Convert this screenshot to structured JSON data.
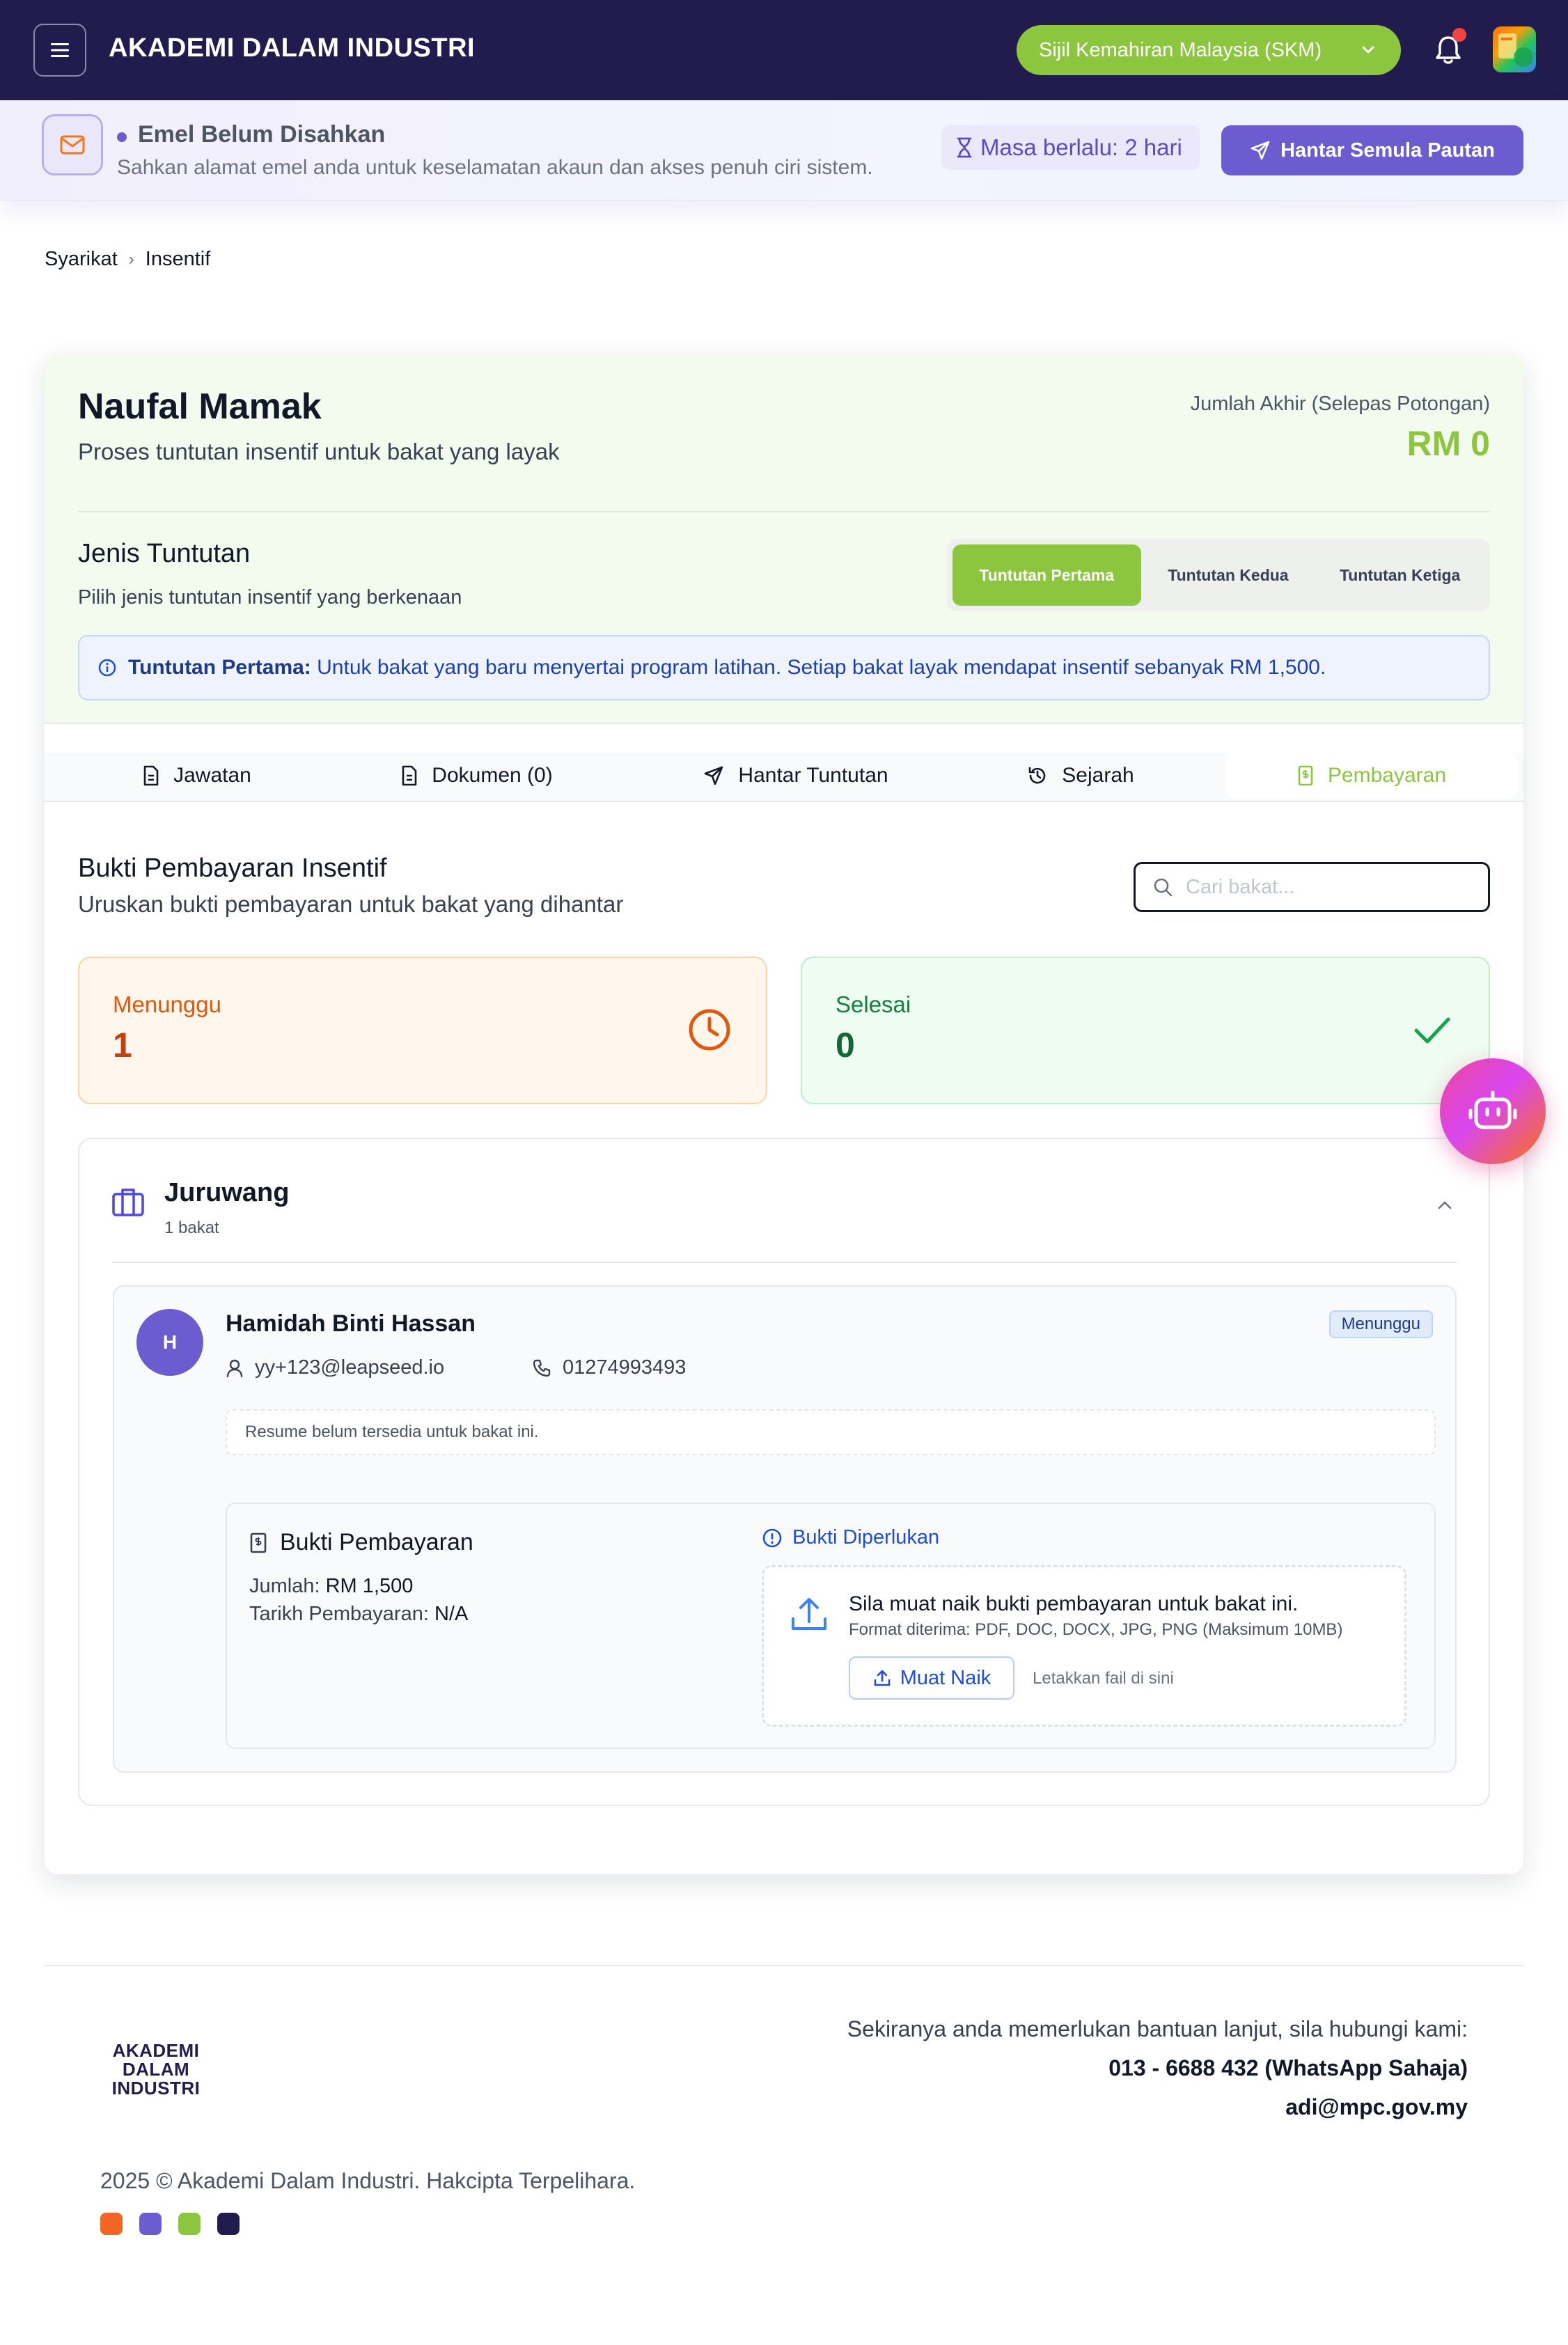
{
  "header": {
    "app_title": "AKADEMI DALAM INDUSTRI",
    "program_select": "Sijil Kemahiran Malaysia (SKM)",
    "icons": [
      "menu-icon",
      "chevron-down-icon",
      "bell-icon",
      "avatar"
    ]
  },
  "banner": {
    "title": "Emel Belum Disahkan",
    "subtitle": "Sahkan alamat emel anda untuk keselamatan akaun dan akses penuh ciri sistem.",
    "elapsed": "Masa berlalu: 2 hari",
    "resend_label": "Hantar Semula Pautan"
  },
  "breadcrumb": {
    "items": [
      "Syarikat",
      "Insentif"
    ],
    "separator": "›"
  },
  "profile": {
    "name": "Naufal Mamak",
    "subtitle": "Proses tuntutan insentif untuk bakat yang layak",
    "total_label": "Jumlah Akhir (Selepas Potongan)",
    "total_value": "RM 0"
  },
  "claim_type": {
    "title": "Jenis Tuntutan",
    "subtitle": "Pilih jenis tuntutan insentif yang berkenaan",
    "options": [
      "Tuntutan Pertama",
      "Tuntutan Kedua",
      "Tuntutan Ketiga"
    ],
    "selected": "Tuntutan Pertama",
    "info_bold": "Tuntutan Pertama:",
    "info_text": " Untuk bakat yang baru menyertai program latihan. Setiap bakat layak mendapat insentif sebanyak RM 1,500."
  },
  "tabs": {
    "items": [
      "Jawatan",
      "Dokumen (0)",
      "Hantar Tuntutan",
      "Sejarah",
      "Pembayaran"
    ],
    "active": "Pembayaran"
  },
  "payment": {
    "title": "Bukti Pembayaran Insentif",
    "subtitle": "Uruskan bukti pembayaran untuk bakat yang dihantar",
    "search_placeholder": "Cari bakat...",
    "stats": {
      "pending_label": "Menunggu",
      "pending_value": "1",
      "done_label": "Selesai",
      "done_value": "0"
    }
  },
  "group": {
    "title": "Juruwang",
    "count": "1 bakat",
    "talent": {
      "initial": "H",
      "name": "Hamidah Binti Hassan",
      "status": "Menunggu",
      "email": "yy+123@leapseed.io",
      "phone": "01274993493",
      "resume_note": "Resume belum tersedia untuk bakat ini.",
      "proof": {
        "title": "Bukti Pembayaran",
        "amount_label": "Jumlah: ",
        "amount_value": "RM 1,500",
        "date_label": "Tarikh Pembayaran: ",
        "date_value": "N/A",
        "required_label": "Bukti Diperlukan",
        "upload_title": "Sila muat naik bukti pembayaran untuk bakat ini.",
        "upload_formats": "Format diterima: PDF, DOC, DOCX, JPG, PNG (Maksimum 10MB)",
        "upload_button": "Muat Naik",
        "drop_hint": "Letakkan fail di sini"
      }
    }
  },
  "footer": {
    "logo_lines": [
      "AKADEMI",
      "DALAM",
      "INDUSTRI"
    ],
    "help_text": "Sekiranya anda memerlukan bantuan lanjut, sila hubungi kami:",
    "phone": "013 - 6688 432 (WhatsApp Sahaja)",
    "email": "adi@mpc.gov.my",
    "copyright": "2025 © Akademi Dalam Industri. Hakcipta Terpelihara.",
    "swatches": [
      "#f26522",
      "#6d5bd0",
      "#8cc63f",
      "#221c4e"
    ]
  },
  "colors": {
    "navy": "#221c4e",
    "brand_green": "#8cc63f",
    "brand_purple": "#6d5bd0",
    "pending_orange": "#e2560e",
    "done_green": "#15803d"
  }
}
